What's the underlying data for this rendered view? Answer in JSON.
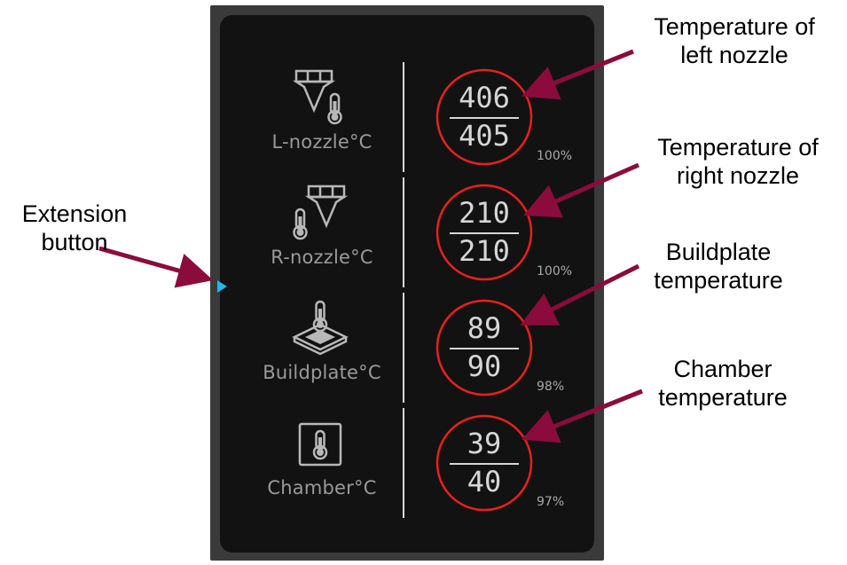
{
  "colors": {
    "panel_bg": "#121212",
    "ring": "#e8201e",
    "text": "#d6d6d6",
    "extension_button": "#1fb7ef",
    "arrow": "#8b0c3c"
  },
  "rows": [
    {
      "label": "L-nozzle°C",
      "icon": "left-nozzle-thermometer-icon",
      "current": "406",
      "target": "405",
      "percent": "100%"
    },
    {
      "label": "R-nozzle°C",
      "icon": "right-nozzle-thermometer-icon",
      "current": "210",
      "target": "210",
      "percent": "100%"
    },
    {
      "label": "Buildplate°C",
      "icon": "buildplate-thermometer-icon",
      "current": "89",
      "target": "90",
      "percent": "98%"
    },
    {
      "label": "Chamber°C",
      "icon": "chamber-thermometer-icon",
      "current": "39",
      "target": "40",
      "percent": "97%"
    }
  ],
  "annotations": {
    "left_nozzle": "Temperature of\nleft nozzle",
    "right_nozzle": "Temperature of\nright nozzle",
    "buildplate": "Buildplate\ntemperature",
    "chamber": "Chamber\ntemperature",
    "extension": "Extension\nbutton"
  }
}
